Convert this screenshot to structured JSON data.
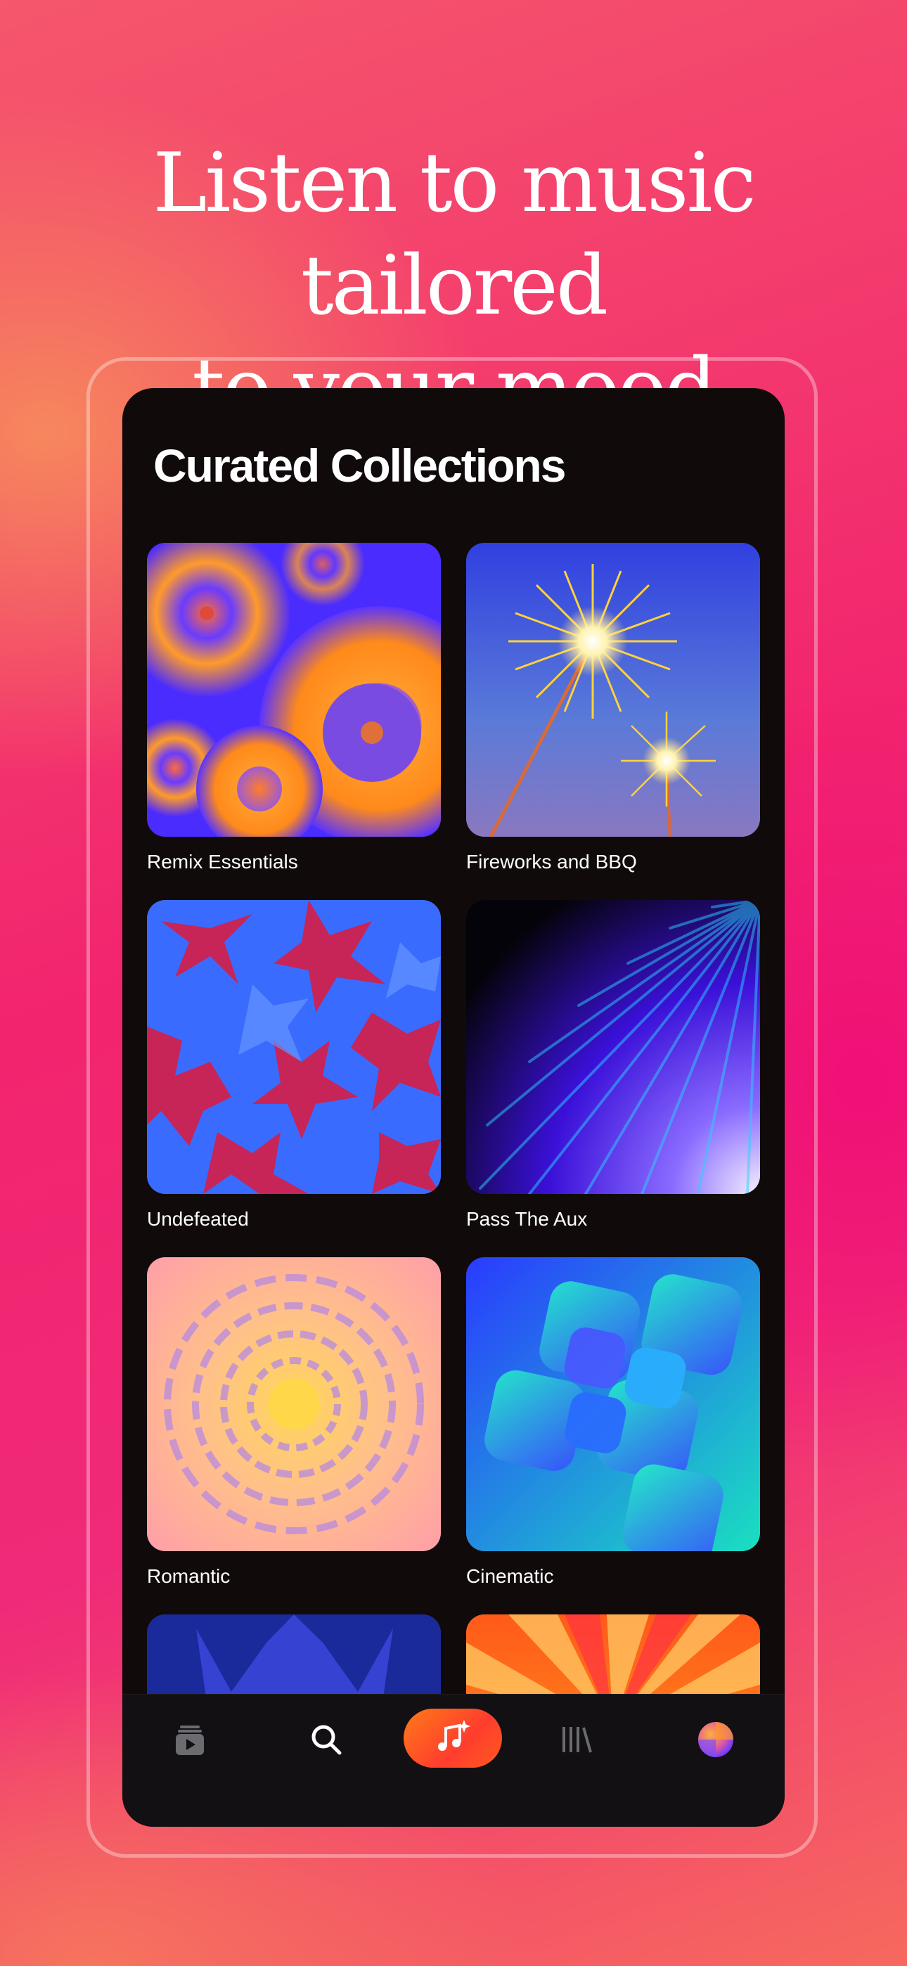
{
  "headline": {
    "line1": "Listen to music tailored",
    "line2": "to your mood"
  },
  "section_title": "Curated Collections",
  "collections": [
    {
      "title": "Remix Essentials",
      "art": "concentric-circles"
    },
    {
      "title": "Fireworks and BBQ",
      "art": "sparklers"
    },
    {
      "title": "Undefeated",
      "art": "stars-red-blue"
    },
    {
      "title": "Pass The Aux",
      "art": "light-rays"
    },
    {
      "title": "Romantic",
      "art": "flower-petals"
    },
    {
      "title": "Cinematic",
      "art": "rounded-squares"
    },
    {
      "title": "",
      "art": "crown-dark-blue"
    },
    {
      "title": "",
      "art": "sunburst-orange"
    }
  ],
  "tabbar": {
    "items": [
      {
        "name": "now-playing-icon"
      },
      {
        "name": "search-icon"
      },
      {
        "name": "ai-music-icon",
        "active": true,
        "accent": "#ff5a1f"
      },
      {
        "name": "library-icon"
      },
      {
        "name": "profile-avatar-icon"
      }
    ]
  }
}
